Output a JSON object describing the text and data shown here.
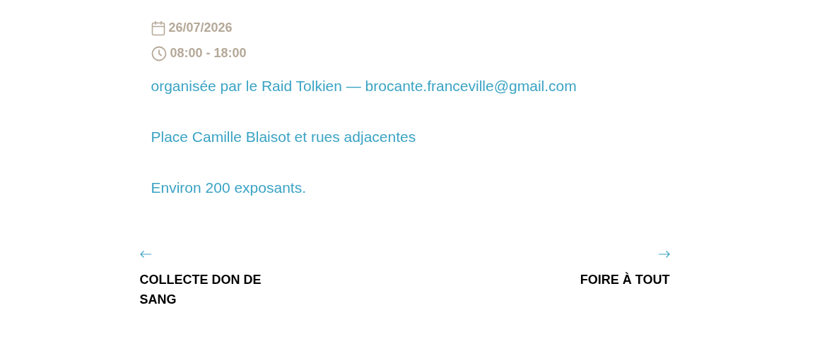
{
  "event": {
    "date": "26/07/2026",
    "time": "08:00 - 18:00"
  },
  "description": [
    "organisée par le Raid Tolkien — brocante.franceville@gmail.com",
    "Place Camille Blaisot et rues adjacentes",
    "Environ 200 exposants."
  ],
  "navigation": [
    {
      "kind": "previous",
      "title": "COLLECTE DON DE SANG"
    },
    {
      "kind": "next",
      "title": "FOIRE À TOUT"
    }
  ]
}
